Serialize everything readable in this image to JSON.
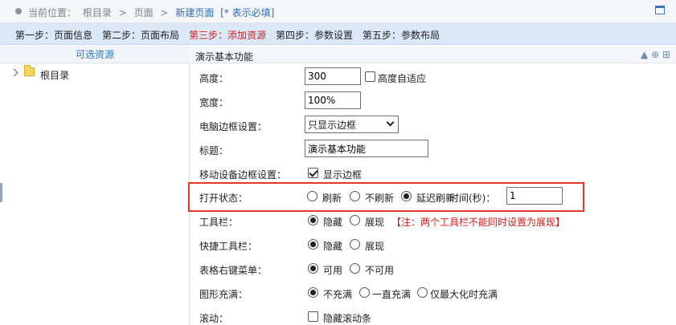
{
  "breadcrumb": {
    "prefix": "当前位置：",
    "items": [
      "根目录",
      "页面"
    ],
    "separator": ">",
    "current": "新建页面",
    "required_note": "[* 表示必填]"
  },
  "steps": [
    {
      "label": "第一步：页面信息",
      "active": false
    },
    {
      "label": "第二步：页面布局",
      "active": false
    },
    {
      "label": "第三步：添加资源",
      "active": true
    },
    {
      "label": "第四步：参数设置",
      "active": false
    },
    {
      "label": "第五步：参数布局",
      "active": false
    }
  ],
  "left_panel": {
    "title": "可选资源",
    "tree": [
      {
        "label": "根目录",
        "expanded": false
      }
    ]
  },
  "form": {
    "title": "演示基本功能",
    "height": {
      "label": "高度：",
      "value": "300",
      "auto_label": "高度自适应",
      "auto_checked": false
    },
    "width": {
      "label": "宽度：",
      "value": "100%"
    },
    "pc_border": {
      "label": "电脑边框设置：",
      "value": "只显示边框"
    },
    "caption": {
      "label": "标题：",
      "value": "演示基本功能"
    },
    "mobile_border": {
      "label": "移动设备边框设置：",
      "option": "显示边框",
      "checked": true
    },
    "open_state": {
      "label": "打开状态：",
      "options": [
        "刷新",
        "不刷新",
        "延迟刷新"
      ],
      "selected": 2,
      "time_label": "时间(秒)：",
      "time_value": "1"
    },
    "toolbar": {
      "label": "工具栏：",
      "options": [
        "隐藏",
        "展现"
      ],
      "selected": 0,
      "note": "【注：两个工具栏不能同时设置为展现】"
    },
    "quick_toolbar": {
      "label": "快捷工具栏：",
      "options": [
        "隐藏",
        "展现"
      ],
      "selected": 0
    },
    "table_context_menu": {
      "label": "表格右键菜单：",
      "options": [
        "可用",
        "不可用"
      ],
      "selected": 0
    },
    "graph_fill": {
      "label": "图形充满：",
      "options": [
        "不充满",
        "一直充满",
        "仅最大化时充满"
      ],
      "selected": 0
    },
    "scroll": {
      "label": "滚动：",
      "option": "隐藏滚动条",
      "checked": false
    }
  },
  "colors": {
    "active_step": "#e21b1b",
    "highlight_border": "#e5372f",
    "link_blue": "#2a79c4",
    "note_red": "#e01818"
  }
}
